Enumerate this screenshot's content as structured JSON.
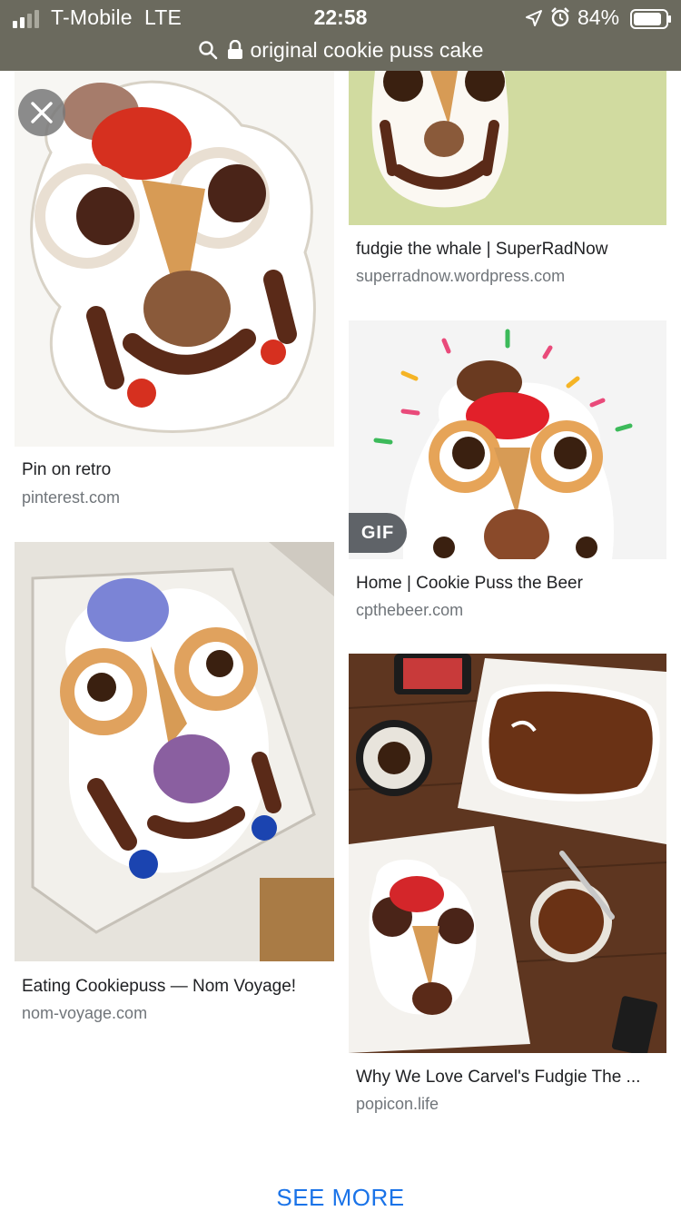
{
  "status_bar": {
    "carrier": "T-Mobile",
    "network": "LTE",
    "time": "22:58",
    "battery": "84%",
    "icons": [
      "signal-icon",
      "location-icon",
      "alarm-icon",
      "battery-icon"
    ]
  },
  "address_bar": {
    "query": "original cookie puss cake",
    "icons": [
      "search-icon",
      "lock-icon"
    ]
  },
  "results": {
    "left": [
      {
        "title": "Pin on retro",
        "domain": "pinterest.com"
      },
      {
        "title": "Eating Cookiepuss — Nom Voyage!",
        "domain": "nom-voyage.com"
      }
    ],
    "right": [
      {
        "title": "fudgie the whale | SuperRadNow",
        "domain": "superradnow.wordpress.com"
      },
      {
        "title": "Home | Cookie Puss the Beer",
        "domain": "cpthebeer.com",
        "badge": "GIF"
      },
      {
        "title": "Why We Love Carvel's Fudgie The ...",
        "domain": "popicon.life"
      }
    ]
  },
  "see_more_label": "SEE MORE",
  "colors": {
    "accent": "#1a73e8",
    "topbar": "#6b6a5e"
  }
}
